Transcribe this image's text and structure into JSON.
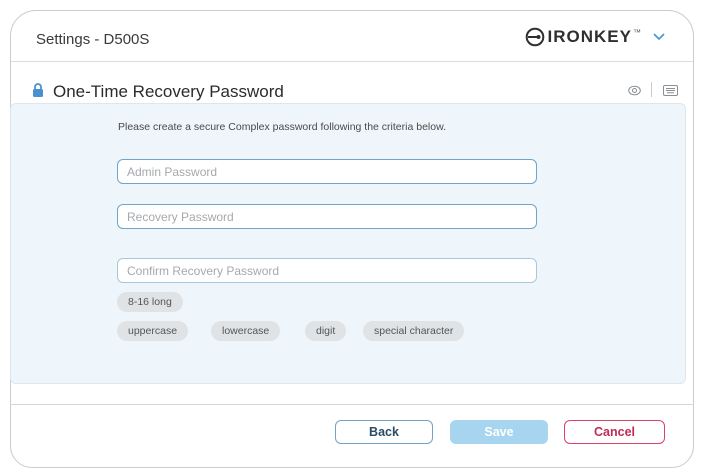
{
  "window": {
    "title": "Settings - D500S",
    "brand_name": "IRONKEY",
    "brand_tm": "™"
  },
  "section": {
    "title": "One-Time Recovery Password"
  },
  "form": {
    "instruction": "Please create a secure Complex password following the criteria below.",
    "admin_placeholder": "Admin Password",
    "recovery_placeholder": "Recovery Password",
    "confirm_placeholder": "Confirm Recovery Password"
  },
  "criteria": [
    "8-16 long",
    "uppercase",
    "lowercase",
    "digit",
    "special character"
  ],
  "buttons": {
    "back": "Back",
    "save": "Save",
    "cancel": "Cancel"
  },
  "colors": {
    "accent": "#6ea5c9",
    "save_disabled": "#a7d5ef",
    "cancel": "#d9416d",
    "panel_bg": "#eef5fb"
  }
}
